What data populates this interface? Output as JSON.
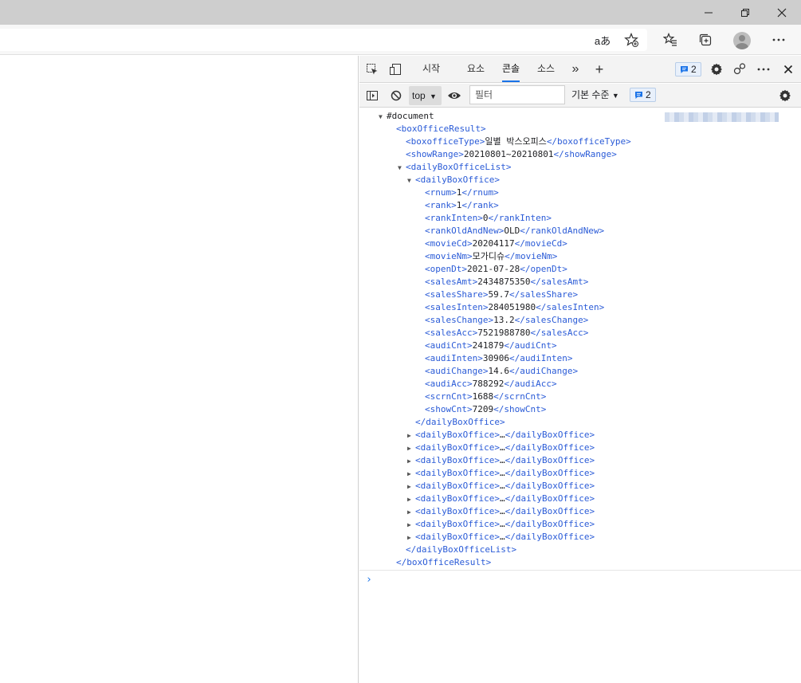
{
  "window": {
    "minimize_icon": "minimize-icon",
    "restore_icon": "restore-icon",
    "close_icon": "close-icon"
  },
  "browser": {
    "read_aloud_glyph": "aあ",
    "icons": [
      "read-aloud-icon",
      "add-favorite-icon",
      "favorites-icon",
      "collections-icon",
      "profile-avatar",
      "more-icon"
    ]
  },
  "devtools": {
    "tabs": [
      "시작",
      "요소",
      "콘솔",
      "소스"
    ],
    "active_tab": "콘솔",
    "more_tabs": "»",
    "add_tab": "+",
    "issues_count": "2",
    "accent": "#1a73e8",
    "console_bar": {
      "context": "top",
      "filter_placeholder": "필터",
      "levels": "기본 수준",
      "issues_count": "2"
    },
    "output": [
      {
        "indent": 0,
        "tri": "▼",
        "open": "#document",
        "text": "",
        "close": "",
        "plain": true
      },
      {
        "indent": 1,
        "tri": "",
        "open": "<boxOfficeResult>",
        "text": "",
        "close": ""
      },
      {
        "indent": 2,
        "tri": "",
        "open": "<boxofficeType>",
        "text": "일별 박스오피스",
        "close": "</boxofficeType>"
      },
      {
        "indent": 2,
        "tri": "",
        "open": "<showRange>",
        "text": "20210801~20210801",
        "close": "</showRange>"
      },
      {
        "indent": 2,
        "tri": "▼",
        "open": "<dailyBoxOfficeList>",
        "text": "",
        "close": ""
      },
      {
        "indent": 3,
        "tri": "▼",
        "open": "<dailyBoxOffice>",
        "text": "",
        "close": ""
      },
      {
        "indent": 4,
        "tri": "",
        "open": "<rnum>",
        "text": "1",
        "close": "</rnum>"
      },
      {
        "indent": 4,
        "tri": "",
        "open": "<rank>",
        "text": "1",
        "close": "</rank>"
      },
      {
        "indent": 4,
        "tri": "",
        "open": "<rankInten>",
        "text": "0",
        "close": "</rankInten>"
      },
      {
        "indent": 4,
        "tri": "",
        "open": "<rankOldAndNew>",
        "text": "OLD",
        "close": "</rankOldAndNew>"
      },
      {
        "indent": 4,
        "tri": "",
        "open": "<movieCd>",
        "text": "20204117",
        "close": "</movieCd>"
      },
      {
        "indent": 4,
        "tri": "",
        "open": "<movieNm>",
        "text": "모가디슈",
        "close": "</movieNm>"
      },
      {
        "indent": 4,
        "tri": "",
        "open": "<openDt>",
        "text": "2021-07-28",
        "close": "</openDt>"
      },
      {
        "indent": 4,
        "tri": "",
        "open": "<salesAmt>",
        "text": "2434875350",
        "close": "</salesAmt>"
      },
      {
        "indent": 4,
        "tri": "",
        "open": "<salesShare>",
        "text": "59.7",
        "close": "</salesShare>"
      },
      {
        "indent": 4,
        "tri": "",
        "open": "<salesInten>",
        "text": "284051980",
        "close": "</salesInten>"
      },
      {
        "indent": 4,
        "tri": "",
        "open": "<salesChange>",
        "text": "13.2",
        "close": "</salesChange>"
      },
      {
        "indent": 4,
        "tri": "",
        "open": "<salesAcc>",
        "text": "7521988780",
        "close": "</salesAcc>"
      },
      {
        "indent": 4,
        "tri": "",
        "open": "<audiCnt>",
        "text": "241879",
        "close": "</audiCnt>"
      },
      {
        "indent": 4,
        "tri": "",
        "open": "<audiInten>",
        "text": "30906",
        "close": "</audiInten>"
      },
      {
        "indent": 4,
        "tri": "",
        "open": "<audiChange>",
        "text": "14.6",
        "close": "</audiChange>"
      },
      {
        "indent": 4,
        "tri": "",
        "open": "<audiAcc>",
        "text": "788292",
        "close": "</audiAcc>"
      },
      {
        "indent": 4,
        "tri": "",
        "open": "<scrnCnt>",
        "text": "1688",
        "close": "</scrnCnt>"
      },
      {
        "indent": 4,
        "tri": "",
        "open": "<showCnt>",
        "text": "7209",
        "close": "</showCnt>"
      },
      {
        "indent": 3,
        "tri": "",
        "open": "</dailyBoxOffice>",
        "text": "",
        "close": ""
      },
      {
        "indent": 3,
        "tri": "▶",
        "open": "<dailyBoxOffice>",
        "text": "…",
        "close": "</dailyBoxOffice>"
      },
      {
        "indent": 3,
        "tri": "▶",
        "open": "<dailyBoxOffice>",
        "text": "…",
        "close": "</dailyBoxOffice>"
      },
      {
        "indent": 3,
        "tri": "▶",
        "open": "<dailyBoxOffice>",
        "text": "…",
        "close": "</dailyBoxOffice>"
      },
      {
        "indent": 3,
        "tri": "▶",
        "open": "<dailyBoxOffice>",
        "text": "…",
        "close": "</dailyBoxOffice>"
      },
      {
        "indent": 3,
        "tri": "▶",
        "open": "<dailyBoxOffice>",
        "text": "…",
        "close": "</dailyBoxOffice>"
      },
      {
        "indent": 3,
        "tri": "▶",
        "open": "<dailyBoxOffice>",
        "text": "…",
        "close": "</dailyBoxOffice>"
      },
      {
        "indent": 3,
        "tri": "▶",
        "open": "<dailyBoxOffice>",
        "text": "…",
        "close": "</dailyBoxOffice>"
      },
      {
        "indent": 3,
        "tri": "▶",
        "open": "<dailyBoxOffice>",
        "text": "…",
        "close": "</dailyBoxOffice>"
      },
      {
        "indent": 3,
        "tri": "▶",
        "open": "<dailyBoxOffice>",
        "text": "…",
        "close": "</dailyBoxOffice>"
      },
      {
        "indent": 2,
        "tri": "",
        "open": "</dailyBoxOfficeList>",
        "text": "",
        "close": ""
      },
      {
        "indent": 1,
        "tri": "",
        "open": "</boxOfficeResult>",
        "text": "",
        "close": ""
      }
    ],
    "prompt": "›"
  }
}
